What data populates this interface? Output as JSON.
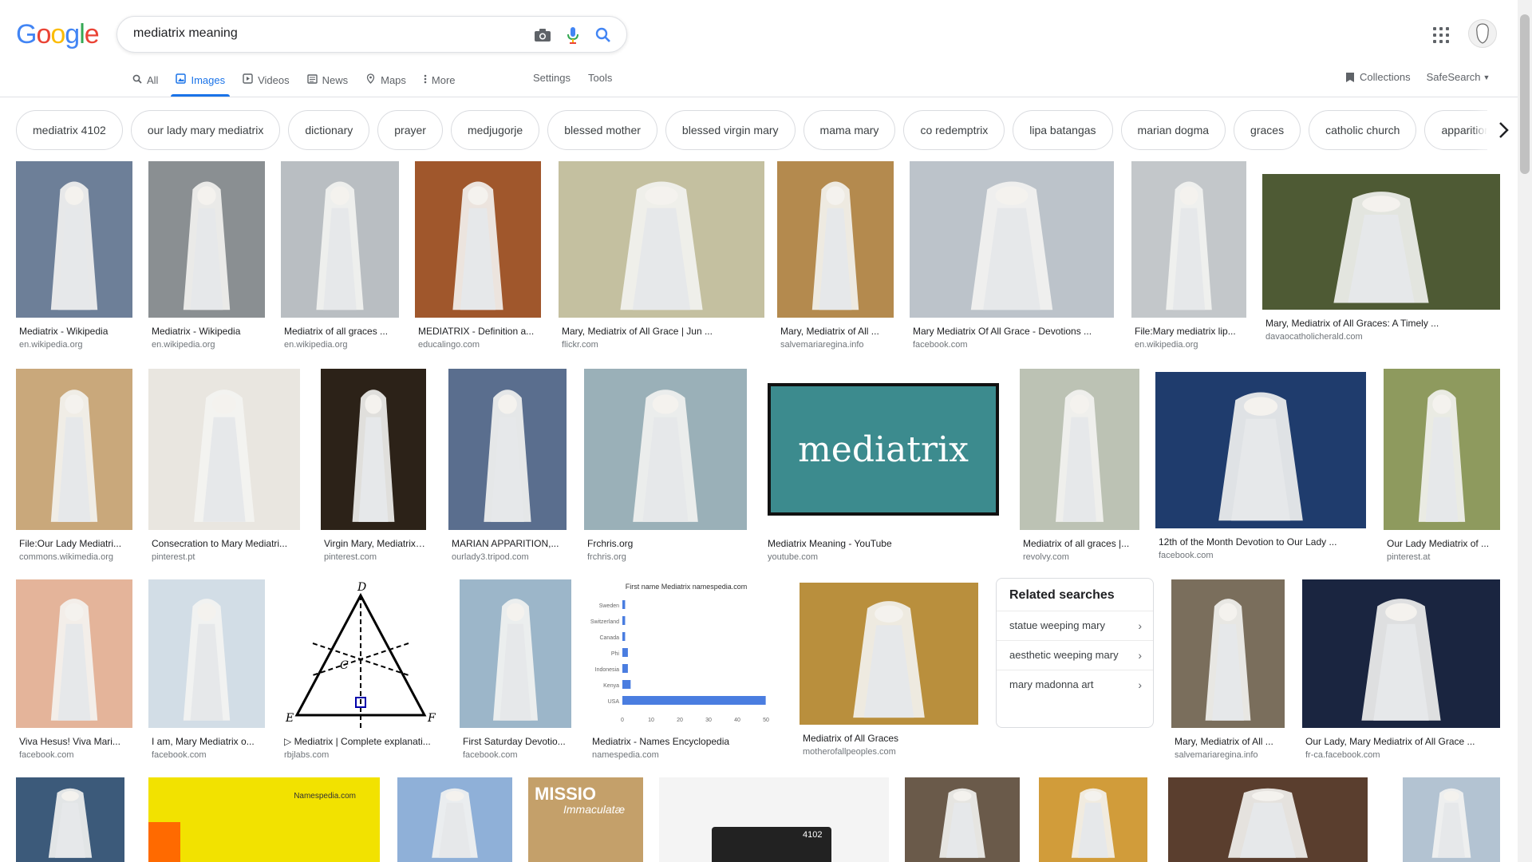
{
  "logo": {
    "letters": [
      "G",
      "o",
      "o",
      "g",
      "l",
      "e"
    ],
    "colors": [
      "#4285F4",
      "#EA4335",
      "#FBBC05",
      "#4285F4",
      "#34A853",
      "#EA4335"
    ]
  },
  "search": {
    "query": "mediatrix meaning",
    "camera_icon": "camera-icon",
    "mic_icon": "mic-icon",
    "search_icon": "search-icon"
  },
  "tabs": [
    {
      "label": "All",
      "icon": "search-icon",
      "active": false
    },
    {
      "label": "Images",
      "icon": "image-icon",
      "active": true
    },
    {
      "label": "Videos",
      "icon": "video-icon",
      "active": false
    },
    {
      "label": "News",
      "icon": "news-icon",
      "active": false
    },
    {
      "label": "Maps",
      "icon": "map-icon",
      "active": false
    },
    {
      "label": "More",
      "icon": "more-vert-icon",
      "active": false
    }
  ],
  "tools": {
    "settings": "Settings",
    "tools": "Tools"
  },
  "right": {
    "collections": "Collections",
    "safesearch": "SafeSearch"
  },
  "chips": [
    "mediatrix 4102",
    "our lady mary mediatrix",
    "dictionary",
    "prayer",
    "medjugorje",
    "blessed mother",
    "blessed virgin mary",
    "mama mary",
    "co redemptrix",
    "lipa batangas",
    "marian dogma",
    "graces",
    "catholic church",
    "apparition"
  ],
  "results": [
    {
      "caption": "Mediatrix - Wikipedia",
      "source": "en.wikipedia.org",
      "color": "#6d7f98"
    },
    {
      "caption": "Mediatrix - Wikipedia",
      "source": "en.wikipedia.org",
      "color": "#8a8f92"
    },
    {
      "caption": "Mediatrix of all graces ...",
      "source": "en.wikipedia.org",
      "color": "#b9bec2"
    },
    {
      "caption": "MEDIATRIX - Definition a...",
      "source": "educalingo.com",
      "color": "#a0572c"
    },
    {
      "caption": "Mary, Mediatrix of All Grace | Jun ...",
      "source": "flickr.com",
      "color": "#c4c0a0"
    },
    {
      "caption": "Mary, Mediatrix of All ...",
      "source": "salvemariaregina.info",
      "color": "#b48a4e"
    },
    {
      "caption": "Mary Mediatrix Of All Grace - Devotions ...",
      "source": "facebook.com",
      "color": "#bcc3ca"
    },
    {
      "caption": "File:Mary mediatrix lip...",
      "source": "en.wikipedia.org",
      "color": "#c3c7ca"
    },
    {
      "caption": "Mary, Mediatrix of All Graces: A Timely ...",
      "source": "davaocatholicherald.com",
      "color": "#4e5a34"
    },
    {
      "caption": "File:Our Lady Mediatri...",
      "source": "commons.wikimedia.org",
      "color": "#c9a87b"
    },
    {
      "caption": "Consecration to Mary Mediatri...",
      "source": "pinterest.pt",
      "color": "#e9e6e0"
    },
    {
      "caption": "Virgin Mary, Mediatrix ...",
      "source": "pinterest.com",
      "color": "#2c2218"
    },
    {
      "caption": "MARIAN APPARITION,...",
      "source": "ourlady3.tripod.com",
      "color": "#5a6e8e"
    },
    {
      "caption": "Frchris.org",
      "source": "frchris.org",
      "color": "#9ab0b8"
    },
    {
      "caption": "Mediatrix Meaning - YouTube",
      "source": "youtube.com",
      "color": "#3c8b8e",
      "overlay": "mediatrix"
    },
    {
      "caption": "Mediatrix of all graces |...",
      "source": "revolvy.com",
      "color": "#bcc2b4"
    },
    {
      "caption": "12th of the Month Devotion to Our Lady ...",
      "source": "facebook.com",
      "color": "#1f3c6d"
    },
    {
      "caption": "Our Lady Mediatrix of ...",
      "source": "pinterest.at",
      "color": "#8e9a5e"
    },
    {
      "caption": "Viva Hesus! Viva Mari...",
      "source": "facebook.com",
      "color": "#e4b49a"
    },
    {
      "caption": "I am, Mary Mediatrix o...",
      "source": "facebook.com",
      "color": "#d2dde6"
    },
    {
      "caption": "▷ Mediatrix | Complete explanati...",
      "source": "rbjlabs.com",
      "color": "#ffffff"
    },
    {
      "caption": "First Saturday Devotio...",
      "source": "facebook.com",
      "color": "#9cb6c9"
    },
    {
      "caption": "Mediatrix - Names Encyclopedia",
      "source": "namespedia.com",
      "color": "#ffffff"
    },
    {
      "caption": "Mediatrix of All Graces",
      "source": "motherofallpeoples.com",
      "color": "#b98f3d"
    },
    {
      "caption": "Mary, Mediatrix of All ...",
      "source": "salvemariaregina.info",
      "color": "#7a6e5c"
    },
    {
      "caption": "Our Lady, Mary Mediatrix of All Grace ...",
      "source": "fr-ca.facebook.com",
      "color": "#1a2540"
    },
    {
      "caption": "",
      "source": "",
      "color": "#3c5a7a"
    },
    {
      "caption": "",
      "source": "",
      "color": "#f2e200"
    },
    {
      "caption": "",
      "source": "",
      "color": "#8fb0d8"
    },
    {
      "caption": "",
      "source": "",
      "color": "#c4a06a"
    },
    {
      "caption": "",
      "source": "",
      "color": "#f4f4f4"
    },
    {
      "caption": "",
      "source": "",
      "color": "#6a5a4a"
    },
    {
      "caption": "",
      "source": "",
      "color": "#d19c3a"
    },
    {
      "caption": "",
      "source": "",
      "color": "#5a3e2e"
    },
    {
      "caption": "",
      "source": "",
      "color": "#b3c3d2"
    }
  ],
  "diagram_letters": {
    "top": "D",
    "left": "E",
    "right": "F",
    "center": "C"
  },
  "names_chart": {
    "title": "First name Mediatrix namespedia.com",
    "labels": [
      "Sweden",
      "Switzerland",
      "Canada",
      "Phi",
      "Indonesia",
      "Kenya",
      "USA"
    ],
    "values": [
      1,
      1,
      1,
      2,
      2,
      3,
      52
    ],
    "ticks": [
      "0",
      "10",
      "20",
      "30",
      "40",
      "50"
    ]
  },
  "tile_texts": {
    "mediatrix_4102": "4102",
    "missio": "MISSIO",
    "missio_sub": "Immaculatæ",
    "namespedia_map": "Namespedia.com"
  },
  "related": {
    "title": "Related searches",
    "items": [
      "statue weeping mary",
      "aesthetic weeping mary",
      "mary madonna art"
    ]
  }
}
